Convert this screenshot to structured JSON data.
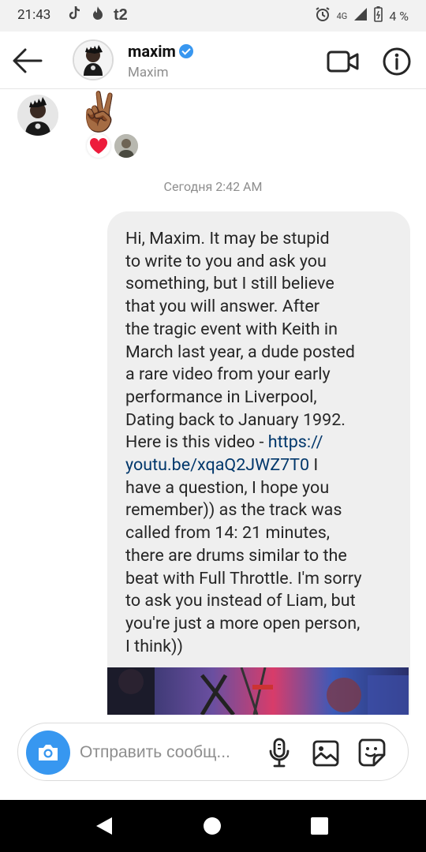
{
  "status_bar": {
    "time": "21:43",
    "network": "4G",
    "battery": "4 %",
    "left_icons": [
      "tiktok-icon",
      "flame-icon",
      "t2-logo"
    ],
    "right_icons": [
      "alarm-icon",
      "signal-icon",
      "battery-icon"
    ],
    "t2_label": "t2"
  },
  "header": {
    "username": "maxim",
    "display_name": "Maxim",
    "verified": true,
    "accent": "#3897f0"
  },
  "chat": {
    "emoji": "✌🏾",
    "reaction_emoji": "❤",
    "timestamp": "Сегодня 2:42 AM",
    "message_lines": [
      "Hi, Maxim. It may be stupid",
      "to write to you and ask you",
      "something, but I still believe",
      "that you will answer. After",
      "the tragic event with Keith in",
      "March last year, a dude posted",
      "a rare video from your early",
      "performance in Liverpool,",
      "Dating back to January 1992.",
      "Here is this video - ",
      "",
      "remember)) as the track was",
      "called from 14: 21 minutes,",
      "there are drums similar to the",
      "beat with Full Throttle. I'm sorry",
      "to ask you instead of Liam, but",
      "you're just a more open person,",
      "I think))"
    ],
    "link_part1": "https://",
    "link_part2": "youtu.be/xqaQ2JWZ7T0",
    "after_link": " I",
    "question_line": "have a question, I hope you"
  },
  "composer": {
    "placeholder": "Отправить сообщ...",
    "camera_color": "#3797f0"
  }
}
